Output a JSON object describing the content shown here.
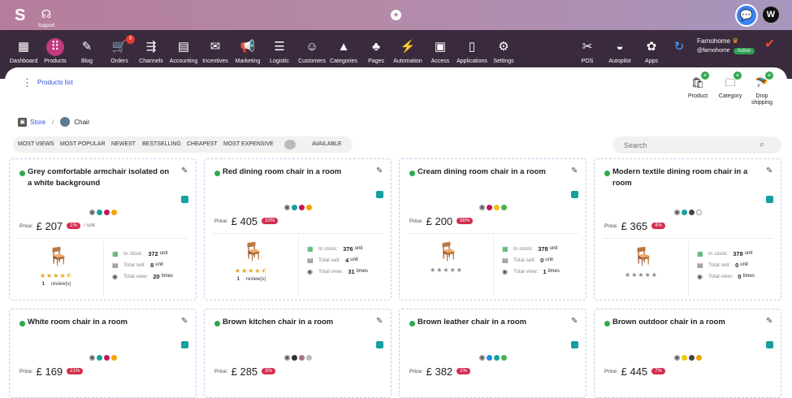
{
  "topbar": {
    "logo_glyph": "S",
    "support_label": "Support",
    "avatar_initial": "W"
  },
  "nav": [
    {
      "label": "Dashboard",
      "glyph": "▦",
      "active": false,
      "badge": ""
    },
    {
      "label": "Products",
      "glyph": "⠿",
      "active": true,
      "badge": ""
    },
    {
      "label": "Blog",
      "glyph": "✎",
      "active": false,
      "badge": ""
    },
    {
      "label": "Orders",
      "glyph": "🛒",
      "active": false,
      "badge": "9"
    },
    {
      "label": "Channels",
      "glyph": "⇶",
      "active": false,
      "badge": ""
    },
    {
      "label": "Accounting",
      "glyph": "▤",
      "active": false,
      "badge": ""
    },
    {
      "label": "Incentives",
      "glyph": "✉",
      "active": false,
      "badge": ""
    },
    {
      "label": "Marketing",
      "glyph": "📢",
      "active": false,
      "badge": ""
    },
    {
      "label": "Logistic",
      "glyph": "☰",
      "active": false,
      "badge": ""
    },
    {
      "label": "Customers",
      "glyph": "☺",
      "active": false,
      "badge": ""
    },
    {
      "label": "Categories",
      "glyph": "▲",
      "active": false,
      "badge": ""
    },
    {
      "label": "Pages",
      "glyph": "♣",
      "active": false,
      "badge": ""
    },
    {
      "label": "Automation",
      "glyph": "⚡",
      "active": false,
      "badge": ""
    },
    {
      "label": "Access",
      "glyph": "▣",
      "active": false,
      "badge": ""
    },
    {
      "label": "Applications",
      "glyph": "▯",
      "active": false,
      "badge": ""
    },
    {
      "label": "Settings",
      "glyph": "⚙",
      "active": false,
      "badge": ""
    }
  ],
  "nav_right": [
    {
      "label": "POS",
      "glyph": "✂"
    },
    {
      "label": "Autopilot",
      "glyph": "◒"
    },
    {
      "label": "Apps",
      "glyph": "✿"
    }
  ],
  "refresh_glyph": "↻",
  "account": {
    "name": "Farnohome",
    "username": "@farnohome",
    "status": "Active"
  },
  "subheader": {
    "title": "Products list"
  },
  "quick_actions": [
    {
      "label": "Product",
      "glyph": "🛍"
    },
    {
      "label": "Category",
      "glyph": "🗀"
    },
    {
      "label": "Drop shipping",
      "glyph": "🪂"
    }
  ],
  "breadcrumb": {
    "store": "Store",
    "current": "Chair"
  },
  "filters": [
    "MOST VIEWS",
    "MOST POPULAR",
    "NEWEST",
    "BESTSELLING",
    "CHEAPEST",
    "MOST EXPENSIVE"
  ],
  "available_label": "AVAILABLE",
  "search": {
    "placeholder": "Search"
  },
  "stat_labels": {
    "in_stock": "In stock:",
    "total_sell": "Total sell:",
    "total_view": "Total view:",
    "unit": "unit",
    "times": "times",
    "per_unit": "/ unit",
    "price": "Price:",
    "reviews": "review(s)"
  },
  "products": [
    {
      "name": "Grey comfortable armchair isolated on a white background",
      "price": "£ 207",
      "discount": "1%",
      "show_unit": true,
      "colors": [
        "tex",
        "#16a0a0",
        "#c2185b",
        "#f4a300"
      ],
      "thumb": "🪑",
      "rating": 4.5,
      "review_count": "1",
      "show_reviews": true,
      "in_stock": "372",
      "total_sell": "8",
      "total_view": "20"
    },
    {
      "name": "Red dining room chair in a room",
      "price": "£ 405",
      "discount": "10%",
      "show_unit": false,
      "colors": [
        "tex",
        "#16a0a0",
        "#c2185b",
        "#f4a300"
      ],
      "thumb": "🪑",
      "rating": 4.5,
      "review_count": "1",
      "show_reviews": true,
      "in_stock": "376",
      "total_sell": "4",
      "total_view": "31"
    },
    {
      "name": "Cream dining room chair in a room",
      "price": "£ 200",
      "discount": "56%",
      "show_unit": false,
      "colors": [
        "tex",
        "#c2185b",
        "#f4c20d",
        "#4caf50"
      ],
      "thumb": "🪑",
      "rating": 0,
      "review_count": "",
      "show_reviews": false,
      "in_stock": "378",
      "total_sell": "0",
      "total_view": "1"
    },
    {
      "name": "Modern textile dining room chair in a room",
      "price": "£ 365",
      "discount": "4%",
      "show_unit": false,
      "colors": [
        "tex",
        "#16a0a0",
        "#444444",
        "empty"
      ],
      "thumb": "🪑",
      "rating": 0,
      "review_count": "",
      "show_reviews": false,
      "in_stock": "378",
      "total_sell": "0",
      "total_view": "0"
    },
    {
      "name": "White room chair in a room",
      "price": "£ 169",
      "discount": "21%",
      "show_unit": false,
      "colors": [
        "tex",
        "#16a0a0",
        "#c2185b",
        "#f4a300"
      ]
    },
    {
      "name": "Brown kitchen chair in a room",
      "price": "£ 285",
      "discount": "3%",
      "show_unit": false,
      "colors": [
        "tex",
        "#333333",
        "#b07080",
        "#bbbbbb"
      ]
    },
    {
      "name": "Brown leather chair in a room",
      "price": "£ 382",
      "discount": "1%",
      "show_unit": false,
      "colors": [
        "tex",
        "#1e88e5",
        "#16a0a0",
        "#4caf50"
      ]
    },
    {
      "name": "Brown outdoor chair in a room",
      "price": "£ 445",
      "discount": "7%",
      "show_unit": false,
      "colors": [
        "tex",
        "#f4c20d",
        "#444444",
        "#f4a300"
      ]
    }
  ]
}
